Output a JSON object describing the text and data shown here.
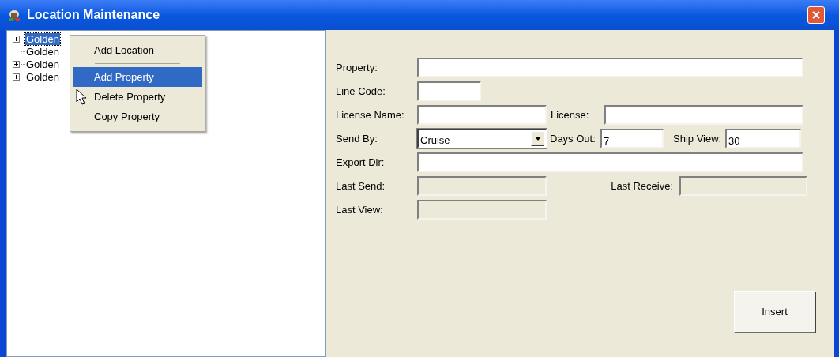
{
  "window": {
    "title": "Location Maintenance"
  },
  "tree": {
    "items": [
      {
        "label": "Golden",
        "expandable": true,
        "selected": true
      },
      {
        "label": "Golden",
        "expandable": false,
        "selected": false
      },
      {
        "label": "Golden",
        "expandable": true,
        "selected": false
      },
      {
        "label": "Golden",
        "expandable": true,
        "selected": false
      }
    ]
  },
  "context_menu": {
    "items": [
      {
        "kind": "item",
        "label": "Add Location",
        "selected": false
      },
      {
        "kind": "separator"
      },
      {
        "kind": "item",
        "label": "Add Property",
        "selected": true
      },
      {
        "kind": "item",
        "label": "Delete Property",
        "selected": false
      },
      {
        "kind": "item",
        "label": "Copy Property",
        "selected": false
      }
    ]
  },
  "form": {
    "rows": [
      [
        {
          "label": "Property:",
          "kind": "text",
          "disabled": false
        }
      ],
      [
        {
          "label": "Line Code:",
          "kind": "text",
          "disabled": false
        }
      ],
      [
        {
          "label": "License Name:",
          "kind": "text",
          "disabled": false
        },
        {
          "label": "License:",
          "kind": "text",
          "disabled": false
        }
      ],
      [
        {
          "label": "Send By:",
          "kind": "select",
          "value": "Cruise"
        },
        {
          "label": "Days Out:",
          "kind": "text",
          "value": "7",
          "disabled": false
        },
        {
          "label": "Ship View:",
          "kind": "text",
          "value": "30",
          "disabled": false
        }
      ],
      [
        {
          "label": "Export Dir:",
          "kind": "text",
          "disabled": false
        }
      ],
      [
        {
          "label": "Last Send:",
          "kind": "text",
          "disabled": true
        },
        {
          "label": "Last Receive:",
          "kind": "text",
          "disabled": true
        }
      ],
      [
        {
          "label": "Last View:",
          "kind": "text",
          "disabled": true
        }
      ]
    ]
  },
  "buttons": [
    {
      "label": "Insert"
    }
  ]
}
